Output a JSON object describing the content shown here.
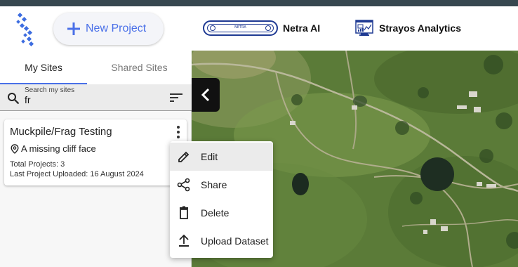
{
  "header": {
    "new_project_label": "New Project",
    "netra_name": "Netra AI",
    "netra_badge_text": "NETRA",
    "strayos_name": "Strayos Analytics"
  },
  "tabs": [
    {
      "label": "My Sites",
      "active": true
    },
    {
      "label": "Shared Sites",
      "active": false
    }
  ],
  "search": {
    "label": "Search my sites",
    "value": "fr"
  },
  "site_card": {
    "title": "Muckpile/Frag Testing",
    "location": "A missing cliff face",
    "total_projects": "Total Projects: 3",
    "last_uploaded": "Last Project Uploaded: 16 August 2024"
  },
  "context_menu": {
    "items": [
      {
        "label": "Edit",
        "icon": "pencil-icon"
      },
      {
        "label": "Share",
        "icon": "share-icon"
      },
      {
        "label": "Delete",
        "icon": "trash-icon"
      },
      {
        "label": "Upload Dataset",
        "icon": "upload-icon"
      }
    ]
  },
  "colors": {
    "accent": "#4a70e8",
    "brand_dark": "#1f3a93",
    "top_strip": "#37474f"
  }
}
